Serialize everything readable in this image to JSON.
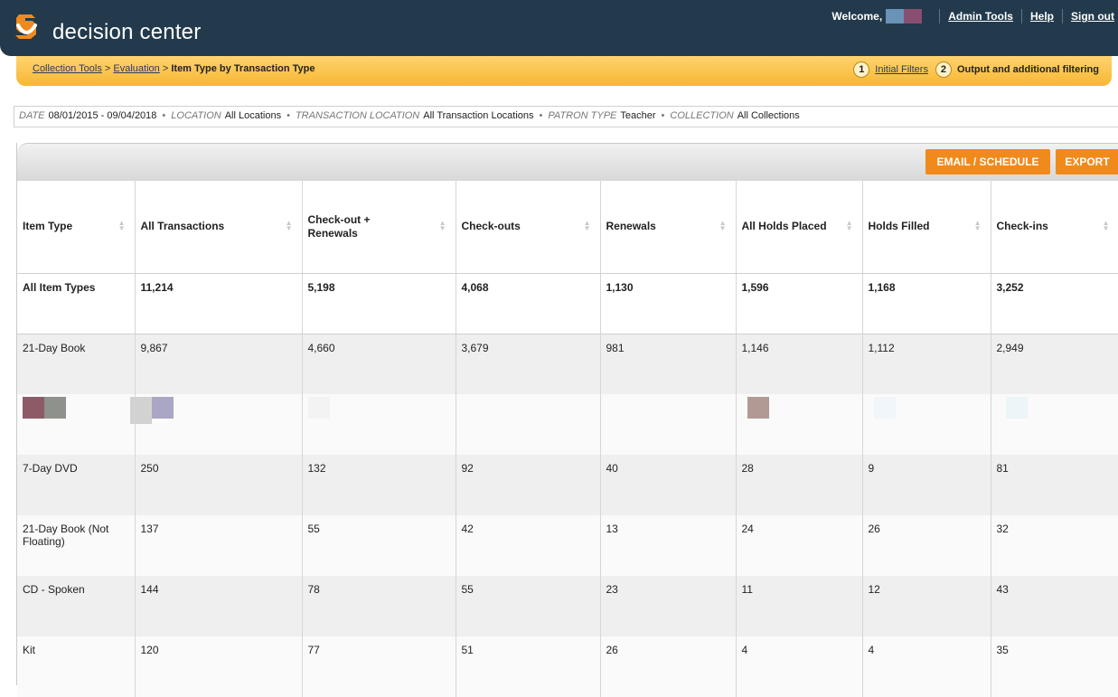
{
  "app": {
    "brand": "decision center"
  },
  "topnav": {
    "welcome": "Welcome,",
    "admin_tools": "Admin Tools",
    "help": "Help",
    "sign_out": "Sign out"
  },
  "breadcrumb": {
    "collection_tools": "Collection Tools",
    "sep": ">",
    "evaluation": "Evaluation",
    "current": "Item Type by Transaction Type"
  },
  "steps": [
    {
      "num": "1",
      "label": "Initial Filters"
    },
    {
      "num": "2",
      "label": "Output and additional filtering"
    }
  ],
  "filters": [
    {
      "key": "DATE",
      "value": "08/01/2015 - 09/04/2018"
    },
    {
      "key": "LOCATION",
      "value": "All Locations"
    },
    {
      "key": "TRANSACTION LOCATION",
      "value": "All Transaction Locations"
    },
    {
      "key": "PATRON TYPE",
      "value": "Teacher"
    },
    {
      "key": "COLLECTION",
      "value": "All Collections"
    }
  ],
  "buttons": {
    "email": "EMAIL / SCHEDULE",
    "export": "EXPORT"
  },
  "table": {
    "columns": [
      "Item Type",
      "All Transactions",
      "Check-out + Renewals",
      "Check-outs",
      "Renewals",
      "All Holds Placed",
      "Holds Filled",
      "Check-ins"
    ],
    "rows": [
      [
        "All Item Types",
        "11,214",
        "5,198",
        "4,068",
        "1,130",
        "1,596",
        "1,168",
        "3,252"
      ],
      [
        "21-Day Book",
        "9,867",
        "4,660",
        "3,679",
        "981",
        "1,146",
        "1,112",
        "2,949"
      ],
      [
        "",
        "",
        "",
        "",
        "",
        "",
        "",
        ""
      ],
      [
        "7-Day DVD",
        "250",
        "132",
        "92",
        "40",
        "28",
        "9",
        "81"
      ],
      [
        "21-Day Book (Not Floating)",
        "137",
        "55",
        "42",
        "13",
        "24",
        "26",
        "32"
      ],
      [
        "CD - Spoken",
        "144",
        "78",
        "55",
        "23",
        "11",
        "12",
        "43"
      ],
      [
        "Kit",
        "120",
        "77",
        "51",
        "26",
        "4",
        "4",
        "35"
      ]
    ]
  },
  "colors": {
    "header_bg": "#223a4c",
    "crumb_bg": "#f7b733",
    "button": "#f08a1c"
  }
}
